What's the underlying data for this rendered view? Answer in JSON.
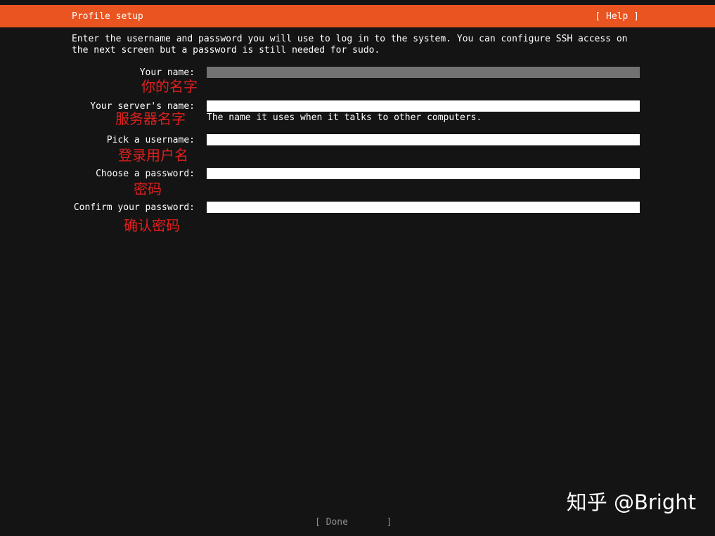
{
  "header": {
    "title": "Profile setup",
    "help_label": "[ Help ]"
  },
  "intro": {
    "line1": "Enter the username and password you will use to log in to the system. You can configure SSH access on",
    "line2": "the next screen but a password is still needed for sudo."
  },
  "form": {
    "fields": [
      {
        "label": "Your name:",
        "value": "",
        "annotation": "你的名字"
      },
      {
        "label": "Your server's name:",
        "value": "",
        "annotation": "服务器名字",
        "hint": "The name it uses when it talks to other computers."
      },
      {
        "label": "Pick a username:",
        "value": "",
        "annotation": "登录用户名"
      },
      {
        "label": "Choose a password:",
        "value": "",
        "annotation": "密码"
      },
      {
        "label": "Confirm your password:",
        "value": "",
        "annotation": "确认密码"
      }
    ]
  },
  "footer": {
    "done_label": "[ Done       ]"
  },
  "watermark": "知乎 @Bright",
  "colors": {
    "header_bg": "#e95420",
    "background": "#141414",
    "focused_field": "#727272",
    "field": "#ffffff",
    "annotation": "#e0201e"
  }
}
